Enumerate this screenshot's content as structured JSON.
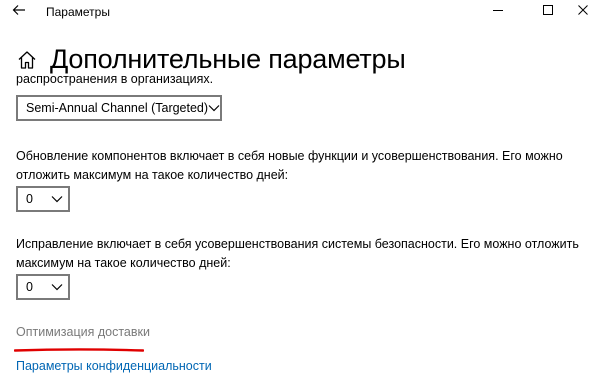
{
  "window": {
    "title": "Параметры"
  },
  "header": {
    "title": "Дополнительные параметры"
  },
  "content": {
    "partial_text": "распространения в организациях.",
    "channel_select": {
      "value": "Semi-Annual Channel (Targeted)"
    },
    "feature_update": {
      "description": "Обновление компонентов включает в себя новые функции и усовершенствования. Его можно отложить максимум на такое количество дней:",
      "value": "0"
    },
    "quality_update": {
      "description": "Исправление включает в себя усовершенствования системы безопасности. Его можно отложить максимум на такое количество дней:",
      "value": "0"
    },
    "delivery_optimization_label": "Оптимизация доставки",
    "privacy_link_label": "Параметры конфиденциальности"
  },
  "colors": {
    "link": "#0066b4",
    "muted_link": "#7a7a7a",
    "highlight_underline": "#e00000",
    "dropdown_border": "#7a7a7a"
  }
}
